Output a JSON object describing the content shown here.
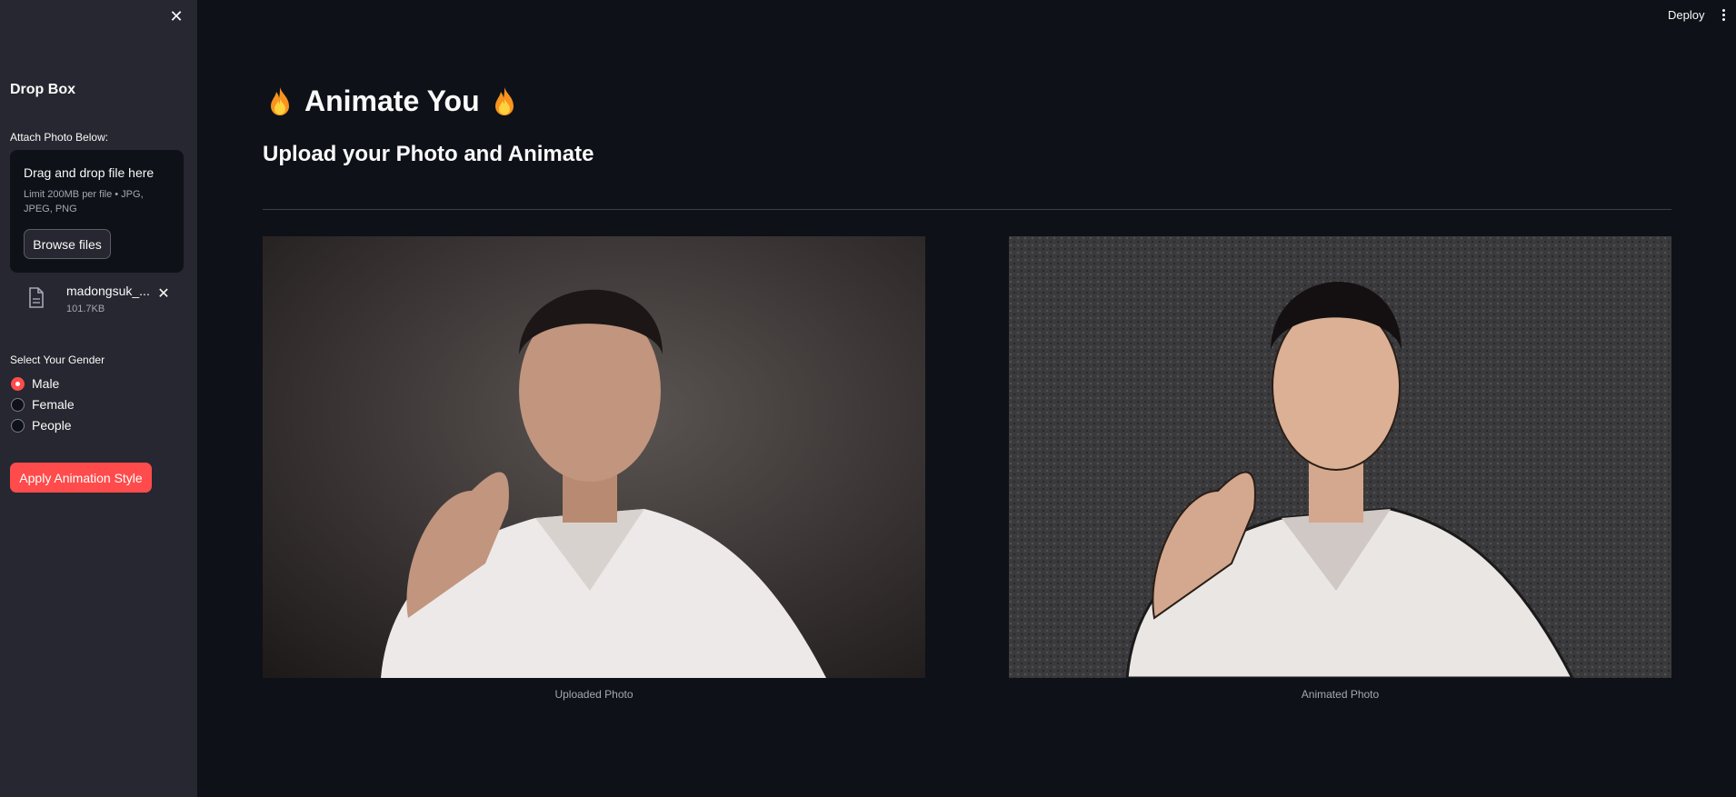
{
  "sidebar": {
    "heading": "Drop Box",
    "attach_label": "Attach Photo Below:",
    "dropzone": {
      "title": "Drag and drop file here",
      "limit": "Limit 200MB per file • JPG, JPEG, PNG",
      "browse_label": "Browse files"
    },
    "file": {
      "name": "madongsuk_...",
      "size": "101.7KB"
    },
    "gender_label": "Select Your Gender",
    "gender_options": [
      {
        "label": "Male",
        "selected": true
      },
      {
        "label": "Female",
        "selected": false
      },
      {
        "label": "People",
        "selected": false
      }
    ],
    "apply_label": "Apply Animation Style"
  },
  "header": {
    "deploy_label": "Deploy"
  },
  "main": {
    "title": "Animate You",
    "subtitle": "Upload your Photo and Animate",
    "images": [
      {
        "caption": "Uploaded Photo"
      },
      {
        "caption": "Animated Photo"
      }
    ]
  },
  "colors": {
    "accent": "#ff4b4b",
    "background": "#0e1117",
    "sidebar": "#262730"
  },
  "icons": {
    "close": "close-icon",
    "file": "file-icon",
    "menu": "kebab-menu-icon",
    "flame": "fire-emoji"
  }
}
